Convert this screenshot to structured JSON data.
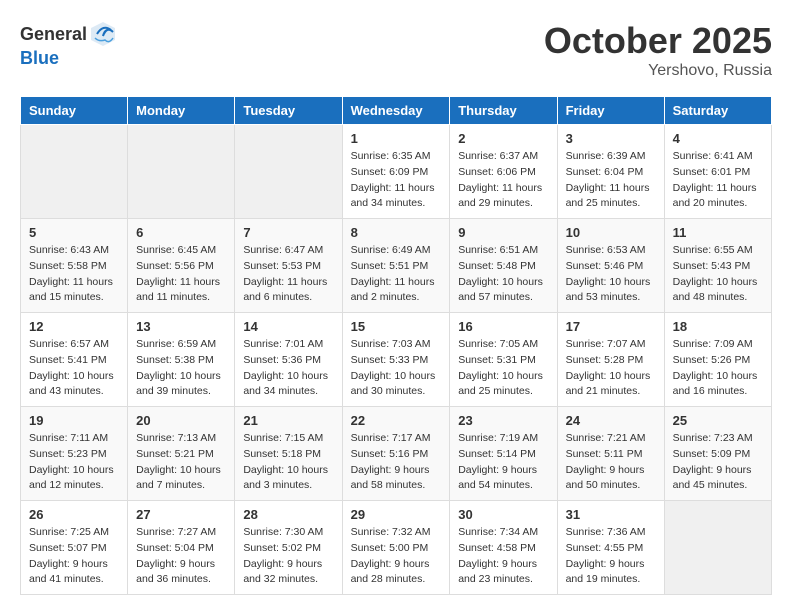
{
  "header": {
    "logo_general": "General",
    "logo_blue": "Blue",
    "month": "October 2025",
    "location": "Yershovo, Russia"
  },
  "weekdays": [
    "Sunday",
    "Monday",
    "Tuesday",
    "Wednesday",
    "Thursday",
    "Friday",
    "Saturday"
  ],
  "weeks": [
    [
      {
        "day": "",
        "info": ""
      },
      {
        "day": "",
        "info": ""
      },
      {
        "day": "",
        "info": ""
      },
      {
        "day": "1",
        "info": "Sunrise: 6:35 AM\nSunset: 6:09 PM\nDaylight: 11 hours\nand 34 minutes."
      },
      {
        "day": "2",
        "info": "Sunrise: 6:37 AM\nSunset: 6:06 PM\nDaylight: 11 hours\nand 29 minutes."
      },
      {
        "day": "3",
        "info": "Sunrise: 6:39 AM\nSunset: 6:04 PM\nDaylight: 11 hours\nand 25 minutes."
      },
      {
        "day": "4",
        "info": "Sunrise: 6:41 AM\nSunset: 6:01 PM\nDaylight: 11 hours\nand 20 minutes."
      }
    ],
    [
      {
        "day": "5",
        "info": "Sunrise: 6:43 AM\nSunset: 5:58 PM\nDaylight: 11 hours\nand 15 minutes."
      },
      {
        "day": "6",
        "info": "Sunrise: 6:45 AM\nSunset: 5:56 PM\nDaylight: 11 hours\nand 11 minutes."
      },
      {
        "day": "7",
        "info": "Sunrise: 6:47 AM\nSunset: 5:53 PM\nDaylight: 11 hours\nand 6 minutes."
      },
      {
        "day": "8",
        "info": "Sunrise: 6:49 AM\nSunset: 5:51 PM\nDaylight: 11 hours\nand 2 minutes."
      },
      {
        "day": "9",
        "info": "Sunrise: 6:51 AM\nSunset: 5:48 PM\nDaylight: 10 hours\nand 57 minutes."
      },
      {
        "day": "10",
        "info": "Sunrise: 6:53 AM\nSunset: 5:46 PM\nDaylight: 10 hours\nand 53 minutes."
      },
      {
        "day": "11",
        "info": "Sunrise: 6:55 AM\nSunset: 5:43 PM\nDaylight: 10 hours\nand 48 minutes."
      }
    ],
    [
      {
        "day": "12",
        "info": "Sunrise: 6:57 AM\nSunset: 5:41 PM\nDaylight: 10 hours\nand 43 minutes."
      },
      {
        "day": "13",
        "info": "Sunrise: 6:59 AM\nSunset: 5:38 PM\nDaylight: 10 hours\nand 39 minutes."
      },
      {
        "day": "14",
        "info": "Sunrise: 7:01 AM\nSunset: 5:36 PM\nDaylight: 10 hours\nand 34 minutes."
      },
      {
        "day": "15",
        "info": "Sunrise: 7:03 AM\nSunset: 5:33 PM\nDaylight: 10 hours\nand 30 minutes."
      },
      {
        "day": "16",
        "info": "Sunrise: 7:05 AM\nSunset: 5:31 PM\nDaylight: 10 hours\nand 25 minutes."
      },
      {
        "day": "17",
        "info": "Sunrise: 7:07 AM\nSunset: 5:28 PM\nDaylight: 10 hours\nand 21 minutes."
      },
      {
        "day": "18",
        "info": "Sunrise: 7:09 AM\nSunset: 5:26 PM\nDaylight: 10 hours\nand 16 minutes."
      }
    ],
    [
      {
        "day": "19",
        "info": "Sunrise: 7:11 AM\nSunset: 5:23 PM\nDaylight: 10 hours\nand 12 minutes."
      },
      {
        "day": "20",
        "info": "Sunrise: 7:13 AM\nSunset: 5:21 PM\nDaylight: 10 hours\nand 7 minutes."
      },
      {
        "day": "21",
        "info": "Sunrise: 7:15 AM\nSunset: 5:18 PM\nDaylight: 10 hours\nand 3 minutes."
      },
      {
        "day": "22",
        "info": "Sunrise: 7:17 AM\nSunset: 5:16 PM\nDaylight: 9 hours\nand 58 minutes."
      },
      {
        "day": "23",
        "info": "Sunrise: 7:19 AM\nSunset: 5:14 PM\nDaylight: 9 hours\nand 54 minutes."
      },
      {
        "day": "24",
        "info": "Sunrise: 7:21 AM\nSunset: 5:11 PM\nDaylight: 9 hours\nand 50 minutes."
      },
      {
        "day": "25",
        "info": "Sunrise: 7:23 AM\nSunset: 5:09 PM\nDaylight: 9 hours\nand 45 minutes."
      }
    ],
    [
      {
        "day": "26",
        "info": "Sunrise: 7:25 AM\nSunset: 5:07 PM\nDaylight: 9 hours\nand 41 minutes."
      },
      {
        "day": "27",
        "info": "Sunrise: 7:27 AM\nSunset: 5:04 PM\nDaylight: 9 hours\nand 36 minutes."
      },
      {
        "day": "28",
        "info": "Sunrise: 7:30 AM\nSunset: 5:02 PM\nDaylight: 9 hours\nand 32 minutes."
      },
      {
        "day": "29",
        "info": "Sunrise: 7:32 AM\nSunset: 5:00 PM\nDaylight: 9 hours\nand 28 minutes."
      },
      {
        "day": "30",
        "info": "Sunrise: 7:34 AM\nSunset: 4:58 PM\nDaylight: 9 hours\nand 23 minutes."
      },
      {
        "day": "31",
        "info": "Sunrise: 7:36 AM\nSunset: 4:55 PM\nDaylight: 9 hours\nand 19 minutes."
      },
      {
        "day": "",
        "info": ""
      }
    ]
  ]
}
